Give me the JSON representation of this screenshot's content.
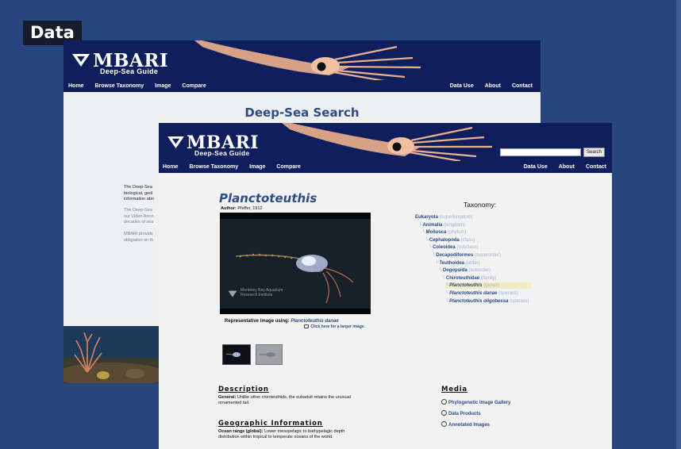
{
  "slide": {
    "title": "Data"
  },
  "colors": {
    "background": "#27457f",
    "header": "#0f1f5e",
    "link": "#2b4a86",
    "title_blue": "#2f4d82",
    "rank_gray": "#9eb3cc",
    "highlight": "#f2ebc2"
  },
  "back_window": {
    "logo": {
      "word": "MBARI",
      "sub": "Deep-Sea Guide",
      "icon": "mbari-logo-icon"
    },
    "nav_left": [
      "Home",
      "Browse Taxonomy",
      "Image",
      "Compare"
    ],
    "nav_right": [
      "Data Use",
      "About",
      "Contact"
    ],
    "page_title": "Deep-Sea Search",
    "para1": [
      "The Deep-Sea",
      "biological, geol",
      "information abo"
    ],
    "para2": [
      "The Deep-Sea",
      "our Video Anno",
      "decades of sea"
    ],
    "para3": [
      "MBARI provide",
      "obligation on th"
    ]
  },
  "front_window": {
    "logo": {
      "word": "MBARI",
      "sub": "Deep-Sea Guide",
      "icon": "mbari-logo-icon"
    },
    "search": {
      "button": "Search",
      "placeholder": ""
    },
    "nav_left": [
      "Home",
      "Browse Taxonomy",
      "Image",
      "Compare"
    ],
    "nav_right": [
      "Data Use",
      "About",
      "Contact"
    ],
    "genus": "Planctoteuthis",
    "author": {
      "label": "Author:",
      "value": "Pfeffer, 1912"
    },
    "video": {
      "watermark_line1": "Monterey Bay Aquarium",
      "watermark_line2": "Research Institute"
    },
    "rep_label": "Representative image using:",
    "rep_species": "Planctoteuthis danae",
    "larger_link": "Click here for a larger image.",
    "taxonomy": {
      "title": "Taxonomy:",
      "rows": [
        {
          "name": "Eukaryota",
          "rank": "(superkingdom)",
          "italic": false
        },
        {
          "name": "Animalia",
          "rank": "(kingdom)",
          "italic": false
        },
        {
          "name": "Mollusca",
          "rank": "(phylum)",
          "italic": false
        },
        {
          "name": "Cephalopoda",
          "rank": "(class)",
          "italic": false
        },
        {
          "name": "Coleoidea",
          "rank": "(subclass)",
          "italic": false
        },
        {
          "name": "Decapodiformes",
          "rank": "(superorder)",
          "italic": false
        },
        {
          "name": "Teuthoidea",
          "rank": "(order)",
          "italic": false
        },
        {
          "name": "Oegopsida",
          "rank": "(suborder)",
          "italic": false
        },
        {
          "name": "Chiroteuthidae",
          "rank": "(family)",
          "italic": false
        },
        {
          "name": "Planctoteuthis",
          "rank": "(genus)",
          "italic": true
        },
        {
          "name": "Planctoteuthis danae",
          "rank": "(species)",
          "italic": true
        },
        {
          "name": "Planctoteuthis oligobessa",
          "rank": "(species)",
          "italic": true
        }
      ]
    },
    "description": {
      "heading": "Description",
      "label": "General:",
      "text_line1": "Unlike other chiroteuthids, the subadult retains the unusual",
      "text_line2": "ornamented tail."
    },
    "geo": {
      "heading": "Geographic Information",
      "label": "Ocean range (global):",
      "text_line1": "Lower mesopelagic to bathypelagic depth",
      "text_line2": "distribution within tropical to temperate oceans of the world."
    },
    "media": {
      "heading": "Media",
      "links": [
        "Phylogenetic Image Gallery",
        "Data Products",
        "Annotated Images"
      ]
    }
  }
}
